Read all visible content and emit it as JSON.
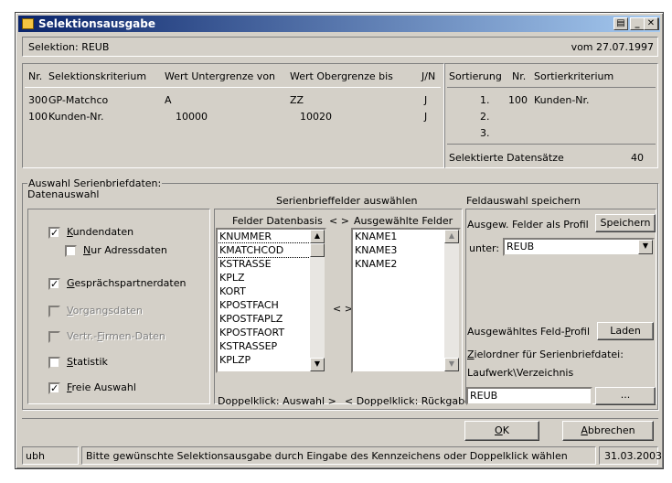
{
  "window": {
    "title": "Selektionsausgabe"
  },
  "header": {
    "selektion": "Selektion: REUB",
    "datum": "vom 27.07.1997"
  },
  "criteria": {
    "headers": {
      "nr": "Nr.",
      "kriterium": "Selektionskriterium",
      "von": "Wert Untergrenze von",
      "bis": "Wert Obergrenze bis",
      "jn": "J/N"
    },
    "rows": [
      {
        "nr": "300",
        "name": "GP-Matchco",
        "von": "A",
        "bis": "ZZ",
        "jn": "J"
      },
      {
        "nr": "100",
        "name": "Kunden-Nr.",
        "von": "10000",
        "bis": "10020",
        "jn": "J"
      }
    ]
  },
  "sort": {
    "headers": {
      "sortierung": "Sortierung",
      "nr": "Nr.",
      "kriterium": "Sortierkriterium"
    },
    "rows": [
      {
        "pos": "1.",
        "nr": "100",
        "name": "Kunden-Nr."
      },
      {
        "pos": "2.",
        "nr": "",
        "name": ""
      },
      {
        "pos": "3.",
        "nr": "",
        "name": ""
      }
    ],
    "count_label": "Selektierte Datensätze",
    "count": "40"
  },
  "group": {
    "title": "Auswahl Serienbriefdaten:",
    "datenauswahl": "Datenauswahl",
    "felder_title": "Serienbrieffelder auswählen",
    "speichern_title": "Feldauswahl speichern"
  },
  "checkboxes": {
    "kundendaten": {
      "pre": "",
      "acc": "K",
      "post": "undendaten",
      "checked": true
    },
    "adressdaten": {
      "pre": "",
      "acc": "N",
      "post": "ur Adressdaten",
      "checked": false
    },
    "gespraech": {
      "pre": "",
      "acc": "G",
      "post": "esprächspartnerdaten",
      "checked": true
    },
    "vorgang": {
      "pre": "",
      "acc": "V",
      "post": "organgsdaten",
      "checked": false
    },
    "vertr": {
      "pre": "Vertr.-",
      "acc": "F",
      "post": "irmen-Daten",
      "checked": false
    },
    "statistik": {
      "pre": "",
      "acc": "S",
      "post": "tatistik",
      "checked": false
    },
    "freie": {
      "pre": "",
      "acc": "F",
      "post": "reie Auswahl",
      "checked": true
    }
  },
  "lists": {
    "left_header": "Felder Datenbasis",
    "arrows_top": "< >",
    "arrows_mid": "< >",
    "right_header": "Ausgewählte Felder",
    "left_items": [
      "KNUMMER",
      "KMATCHCOD",
      "KSTRASSE",
      "KPLZ",
      "KORT",
      "KPOSTFACH",
      "KPOSTFAPLZ",
      "KPOSTFAORT",
      "KSTRASSEP",
      "KPLZP"
    ],
    "right_items": [
      "KNAME1",
      "KNAME3",
      "KNAME2"
    ],
    "hint_left": "Doppelklick: Auswahl >",
    "hint_right": "< Doppelklick: Rückgabe"
  },
  "profile": {
    "label": "Ausgew. Felder als Profil",
    "save_button": "Speichern",
    "unter_label": "unter:",
    "unter_value": "REUB",
    "feld_label_pre": "Ausgewähltes Feld-",
    "feld_label_acc": "P",
    "feld_label_post": "rofil",
    "load_button": "Laden",
    "ziel_acc": "Z",
    "ziel_post": "ielordner für Serienbriefdatei:",
    "laufwerk": "Laufwerk\\Verzeichnis",
    "ziel_value": "REUB",
    "browse": "..."
  },
  "buttons": {
    "ok_acc": "O",
    "ok_post": "K",
    "cancel_acc": "A",
    "cancel_post": "bbrechen"
  },
  "status": {
    "user": "ubh",
    "message": "Bitte gewünschte Selektionsausgabe durch  Eingabe des Kennzeichens oder Doppelklick wählen",
    "date": "31.03.2003"
  }
}
